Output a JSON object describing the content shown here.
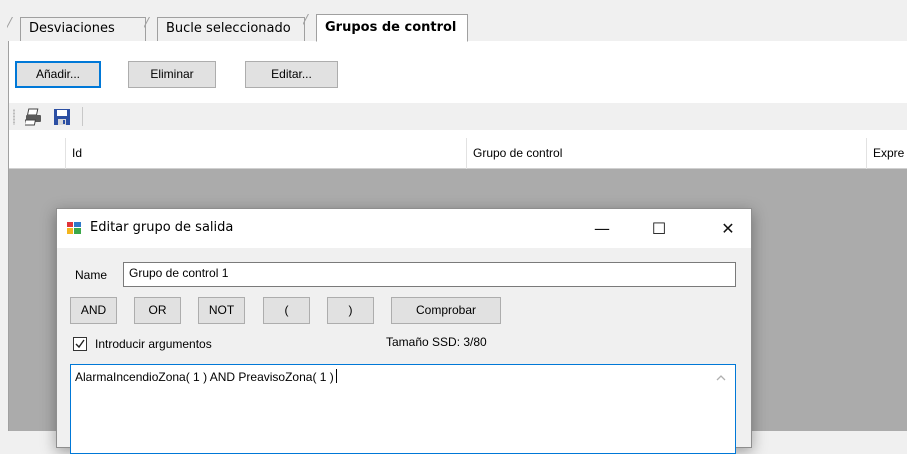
{
  "tabs": [
    {
      "label": "Desviaciones",
      "active": false
    },
    {
      "label": "Bucle seleccionado",
      "active": false
    },
    {
      "label": "Grupos de control",
      "active": true
    }
  ],
  "actions": {
    "add_label": "Añadir...",
    "delete_label": "Eliminar",
    "edit_label": "Editar..."
  },
  "toolbar": {
    "icons": [
      "print-icon",
      "save-icon"
    ]
  },
  "grid": {
    "columns": [
      "Id",
      "Grupo de control",
      "Expre"
    ]
  },
  "dialog": {
    "title": "Editar grupo de salida",
    "minimize_glyph": "—",
    "maximize_glyph": "☐",
    "close_glyph": "✕",
    "name_label": "Name",
    "name_value": "Grupo de control 1",
    "operators": {
      "and": "AND",
      "or": "OR",
      "not": "NOT",
      "open_paren": "(",
      "close_paren": ")",
      "check": "Comprobar"
    },
    "args_label": "Introducir argumentos",
    "args_checked": true,
    "size_text": "Tamaño SSD: 3/80",
    "expression": "AlarmaIncendioZona( 1 ) AND PreavisoZona( 1 )"
  },
  "colors": {
    "accent": "#0078d7",
    "grid_background": "#ababab",
    "window_background": "#f0f0f0"
  }
}
